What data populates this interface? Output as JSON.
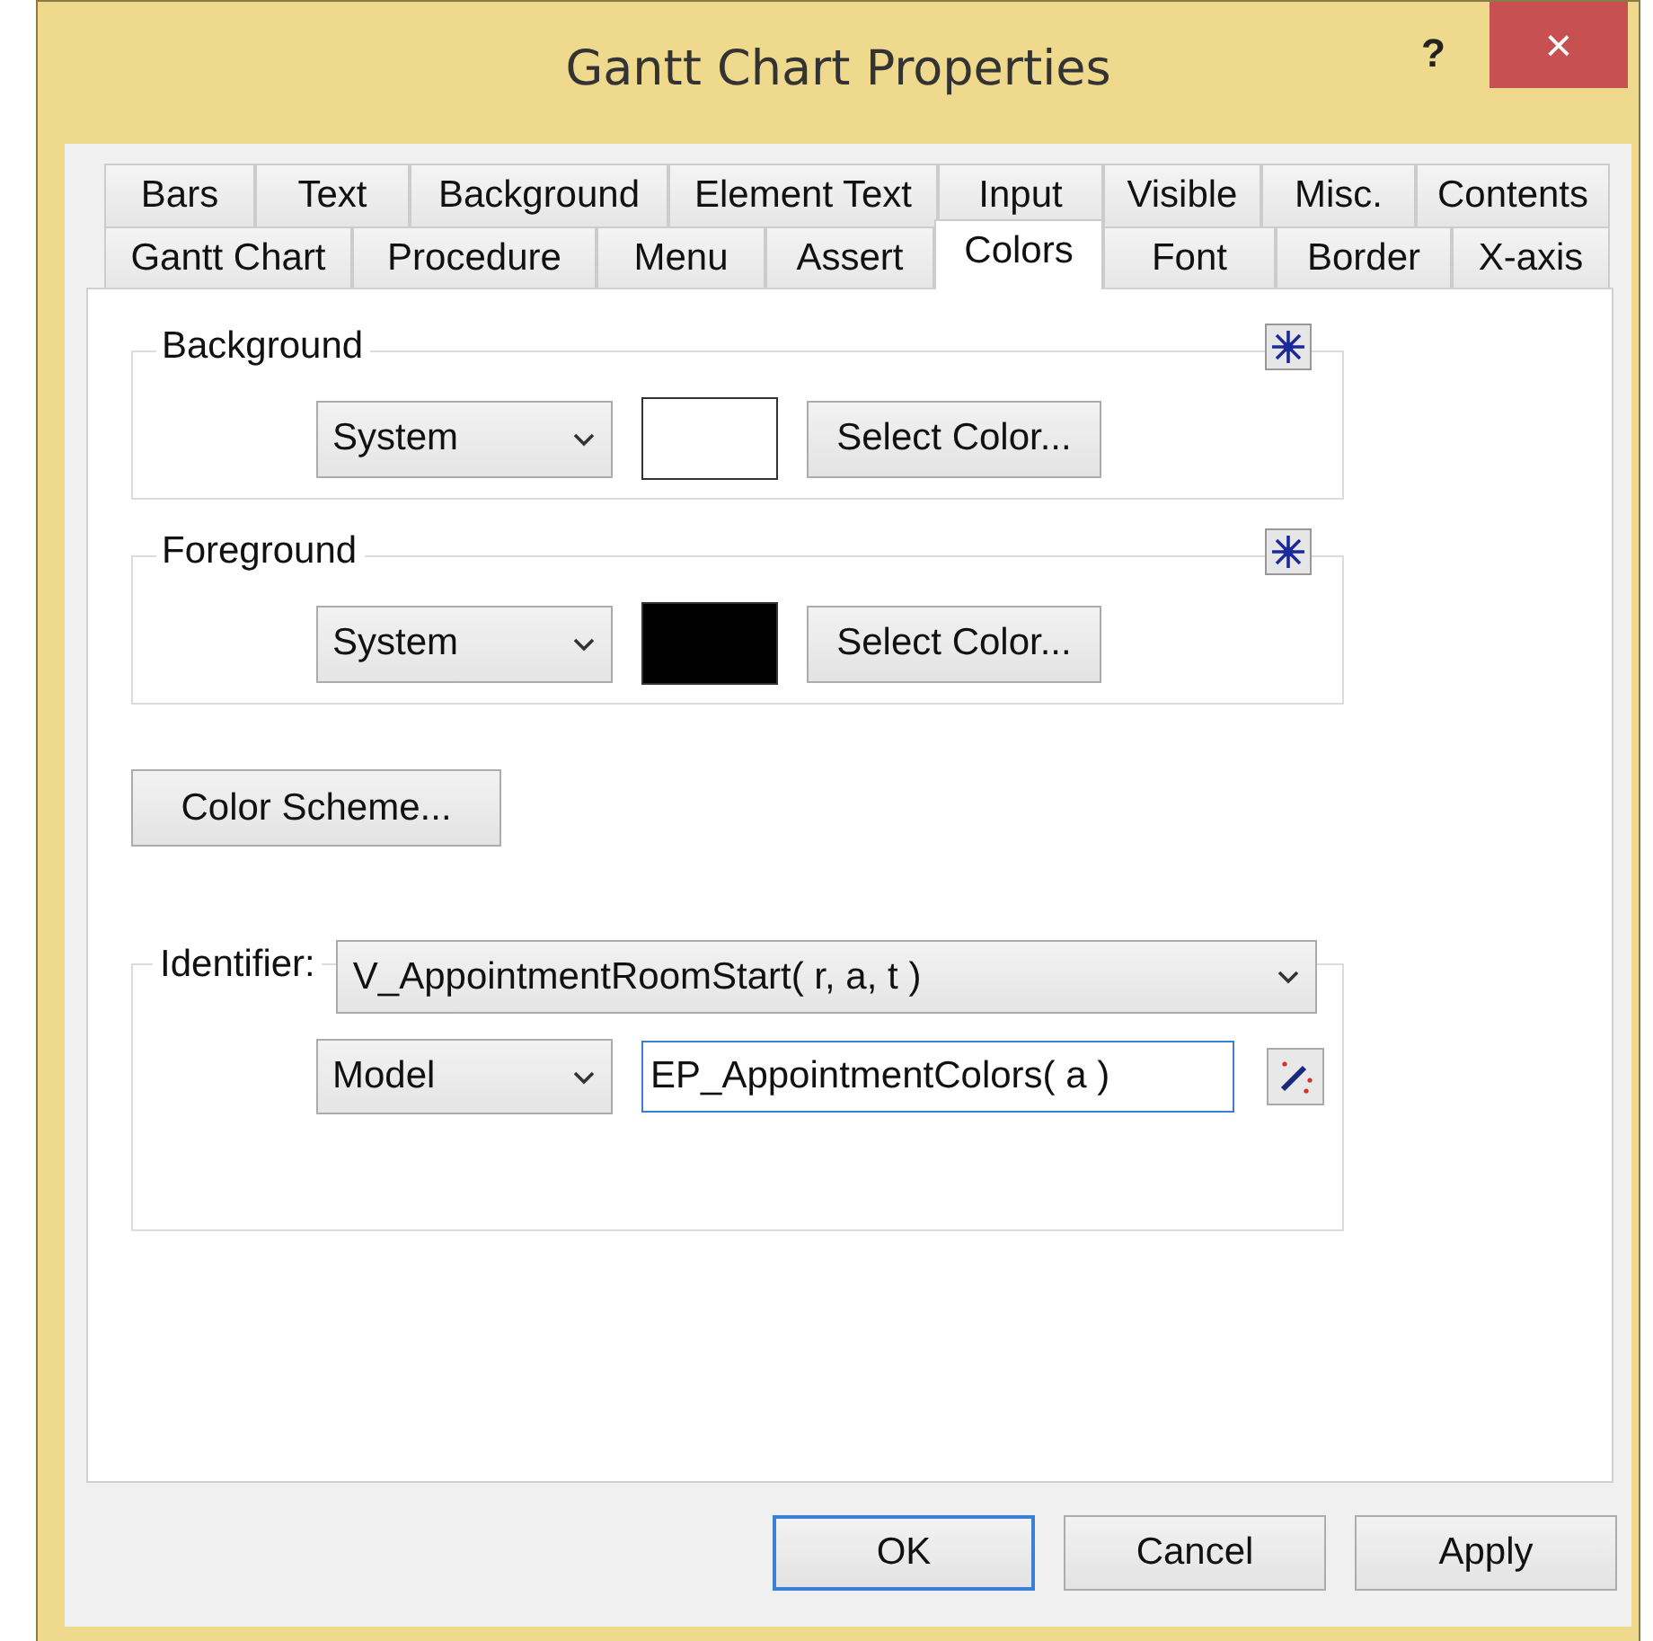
{
  "window": {
    "title": "Gantt Chart Properties",
    "help": "?",
    "close": "×"
  },
  "tab_rows": [
    {
      "tabs": [
        {
          "label": "Bars",
          "selected": false
        },
        {
          "label": "Text",
          "selected": false
        },
        {
          "label": "Background",
          "selected": false
        },
        {
          "label": "Element Text",
          "selected": false
        },
        {
          "label": "Input",
          "selected": false
        },
        {
          "label": "Visible",
          "selected": false
        },
        {
          "label": "Misc.",
          "selected": false
        },
        {
          "label": "Contents",
          "selected": false
        }
      ]
    },
    {
      "tabs": [
        {
          "label": "Gantt Chart",
          "selected": false
        },
        {
          "label": "Procedure",
          "selected": false
        },
        {
          "label": "Menu",
          "selected": false
        },
        {
          "label": "Assert",
          "selected": false
        },
        {
          "label": "Colors",
          "selected": true
        },
        {
          "label": "Font",
          "selected": false
        },
        {
          "label": "Border",
          "selected": false
        },
        {
          "label": "X-axis",
          "selected": false
        }
      ]
    }
  ],
  "color_groups": [
    {
      "legend": "Background",
      "mode": "System",
      "color": "#ffffff",
      "button": "Select Color..."
    },
    {
      "legend": "Foreground",
      "mode": "System",
      "color": "#000000",
      "button": "Select Color..."
    }
  ],
  "color_scheme_button": "Color Scheme...",
  "identifier": {
    "label": "Identifier:",
    "value": "V_AppointmentRoomStart( r, a, t )",
    "source": "Model",
    "expression": "EP_AppointmentColors( a )"
  },
  "buttons": [
    {
      "label": "OK",
      "default": true
    },
    {
      "label": "Cancel",
      "default": false
    },
    {
      "label": "Apply",
      "default": false
    }
  ]
}
